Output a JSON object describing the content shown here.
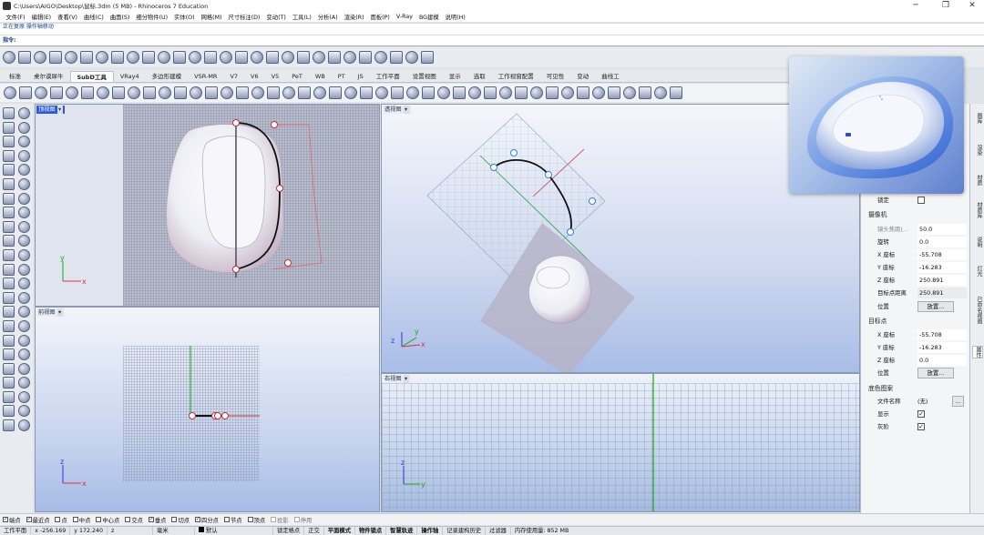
{
  "titlebar": {
    "title": "C:\\Users\\AIGO\\Desktop\\鼠标.3dm (5 MB) - Rhinoceros 7 Education",
    "minimize": "─",
    "restore": "❐",
    "close": "✕"
  },
  "menu": [
    "文件(F)",
    "编辑(E)",
    "查看(V)",
    "曲线(C)",
    "曲面(S)",
    "细分物件(U)",
    "实体(O)",
    "网格(M)",
    "尺寸标注(D)",
    "变动(T)",
    "工具(L)",
    "分析(A)",
    "渲染(R)",
    "面板(P)",
    "V-Ray",
    "BG建模",
    "说明(H)"
  ],
  "command": {
    "history": "正在复原 操作轴移动",
    "prompt": "指令:"
  },
  "tabs": {
    "items": [
      "标准",
      "桌尔谟犀牛",
      "SubD工具",
      "VRay4",
      "多边形建模",
      "VSR-MR",
      "V7",
      "V6",
      "V5",
      "PeT",
      "WB",
      "PT",
      "JS",
      "工作平面",
      "设置视图",
      "显示",
      "选取",
      "工作视窗配置",
      "可见性",
      "变动",
      "曲线工"
    ],
    "active_index": 2
  },
  "viewports": {
    "top": "顶视图",
    "perspective": "透视图",
    "front": "前视图",
    "right": "右视图",
    "axis_x": "x",
    "axis_y": "y",
    "axis_z": "z"
  },
  "properties": {
    "lock_label": "锁定",
    "camera_section": "摄像机",
    "lens_label": "镜头焦距(...",
    "lens_value": "50.0",
    "rotate_label": "旋转",
    "rotate_value": "0.0",
    "cam_x_label": "X 座标",
    "cam_x_value": "-55.708",
    "cam_y_label": "Y 座标",
    "cam_y_value": "-16.283",
    "cam_z_label": "Z 座标",
    "cam_z_value": "250.891",
    "target_dist_label": "目标点距离",
    "target_dist_value": "250.891",
    "position_label": "位置",
    "place_button": "放置...",
    "target_section": "目标点",
    "tgt_x_label": "X 座标",
    "tgt_x_value": "-55.708",
    "tgt_y_label": "Y 座标",
    "tgt_y_value": "-16.283",
    "tgt_z_label": "Z 座标",
    "tgt_z_value": "0.0",
    "tgt_position_label": "位置",
    "tgt_place_button": "放置...",
    "bg_section": "底色图案",
    "filename_label": "文件名称",
    "filename_value": "(无)",
    "browse_button": "...",
    "show_label": "显示",
    "gray_label": "灰阶"
  },
  "right_tabs": [
    "图库",
    "渲染",
    "材质",
    "材质库",
    "说明",
    "灯光",
    "已命名视图",
    "属性"
  ],
  "osnap": [
    {
      "label": "端点",
      "checked": true
    },
    {
      "label": "最近点",
      "checked": true
    },
    {
      "label": "点",
      "checked": false
    },
    {
      "label": "中点",
      "checked": false
    },
    {
      "label": "中心点",
      "checked": false
    },
    {
      "label": "交点",
      "checked": false
    },
    {
      "label": "垂点",
      "checked": true
    },
    {
      "label": "切点",
      "checked": false
    },
    {
      "label": "四分点",
      "checked": true
    },
    {
      "label": "节点",
      "checked": false
    },
    {
      "label": "顶点",
      "checked": false
    },
    {
      "label": "投影",
      "checked": false
    },
    {
      "label": "停用",
      "checked": false
    }
  ],
  "status": {
    "cplane": "工作平面",
    "x": "x -256.169",
    "y": "y 172.240",
    "z": "z",
    "unit": "毫米",
    "layer": "默认",
    "grid_snap": "锁定格点",
    "ortho": "正交",
    "planar": "平面模式",
    "osnap": "物件锁点",
    "smarttrack": "智慧轨迹",
    "gumball": "操作轴",
    "history": "记录建构历史",
    "filter": "过滤器",
    "memory": "内存使用量: 852 MB"
  },
  "colors": {
    "active_viewport": "#2b5ad7",
    "curve": "#111111",
    "control_point": "#e0303a",
    "axis_x": "#e0303a",
    "axis_y": "#19a619",
    "axis_z": "#2b3bd6"
  }
}
